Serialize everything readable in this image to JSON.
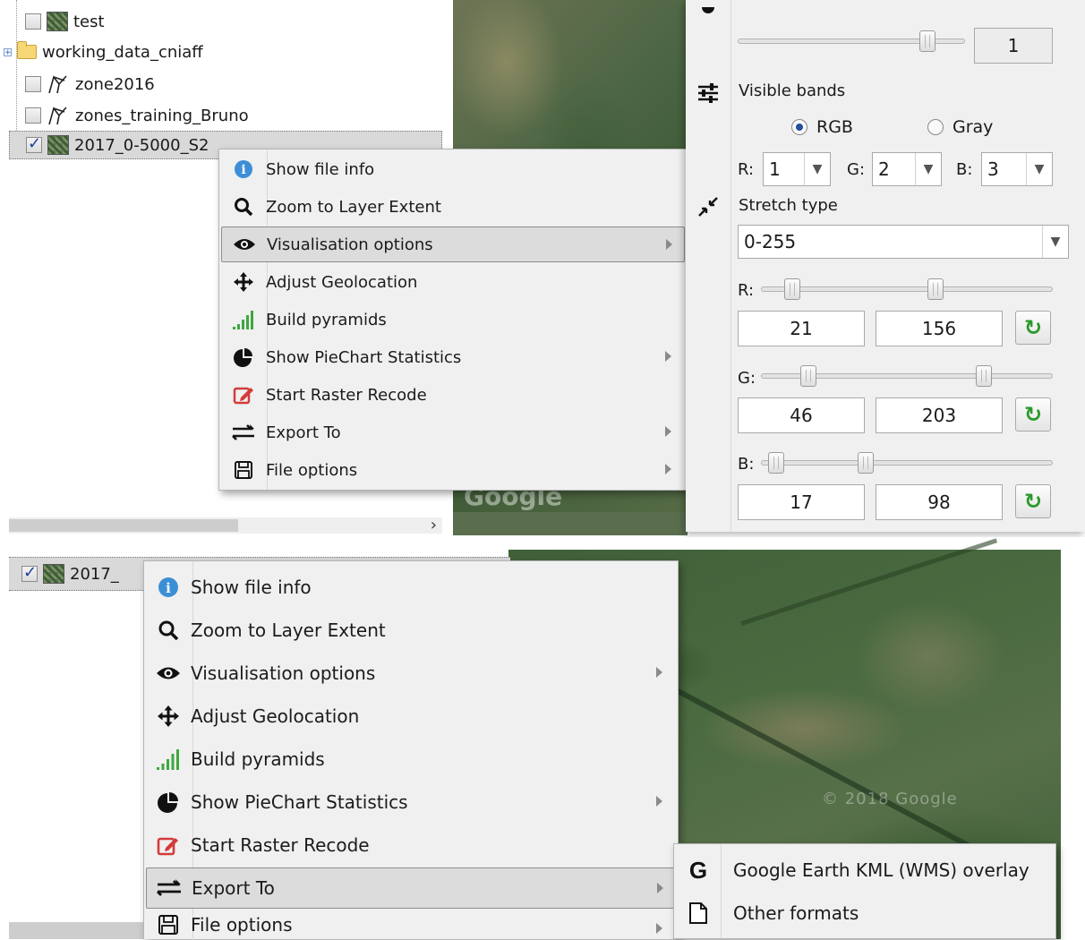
{
  "tree": {
    "items": [
      {
        "label": "test",
        "checked": false,
        "type": "raster"
      },
      {
        "label": "working_data_cniaff",
        "type": "folder"
      },
      {
        "label": "zone2016",
        "checked": false,
        "type": "vector"
      },
      {
        "label": "zones_training_Bruno",
        "checked": false,
        "type": "vector"
      },
      {
        "label": "2017_0-5000_S2",
        "checked": true,
        "type": "raster"
      }
    ],
    "bottom_item_label": "2017_",
    "expander_label": "+"
  },
  "context_menu": {
    "items": [
      {
        "label": "Show file info",
        "icon": "info-icon",
        "submenu": false
      },
      {
        "label": "Zoom to Layer Extent",
        "icon": "magnifier-icon",
        "submenu": false
      },
      {
        "label": "Visualisation options",
        "icon": "eye-icon",
        "submenu": true
      },
      {
        "label": "Adjust Geolocation",
        "icon": "move-arrows-icon",
        "submenu": false
      },
      {
        "label": "Build pyramids",
        "icon": "signal-bars-icon",
        "submenu": false
      },
      {
        "label": "Show PieChart Statistics",
        "icon": "pie-chart-icon",
        "submenu": true
      },
      {
        "label": "Start Raster Recode",
        "icon": "edit-icon",
        "submenu": false
      },
      {
        "label": "Export To",
        "icon": "exchange-arrows-icon",
        "submenu": true
      },
      {
        "label": "File options",
        "icon": "floppy-disk-icon",
        "submenu": true
      }
    ],
    "top_highlighted": "Visualisation options",
    "bottom_highlighted": "Export To"
  },
  "visualisation_panel": {
    "opacity_value": "1",
    "opacity_level": 0.86,
    "visible_bands_label": "Visible bands",
    "mode_rgb": "RGB",
    "mode_gray": "Gray",
    "selected_mode": "RGB",
    "r_label": "R:",
    "g_label": "G:",
    "b_label": "B:",
    "r_band": "1",
    "g_band": "2",
    "b_band": "3",
    "stretch_type_label": "Stretch type",
    "stretch_type_value": "0-255",
    "channels": [
      {
        "label": "R:",
        "min": "21",
        "max": "156"
      },
      {
        "label": "G:",
        "min": "46",
        "max": "203"
      },
      {
        "label": "B:",
        "min": "17",
        "max": "98"
      }
    ]
  },
  "export_submenu": {
    "items": [
      {
        "label": "Google Earth KML (WMS) overlay",
        "icon": "google-g-icon"
      },
      {
        "label": "Other formats",
        "icon": "document-icon"
      }
    ]
  },
  "map": {
    "logo_text": "Google",
    "copyright_text": "© 2018 Google"
  },
  "colors": {
    "menu_bg": "#f0f0f0",
    "highlight_bg": "#dcdcdc",
    "refresh_green": "#2a9a2a",
    "info_blue": "#3c8fd6",
    "recode_red": "#d33b3b",
    "pyramid_green": "#3fa83f"
  }
}
